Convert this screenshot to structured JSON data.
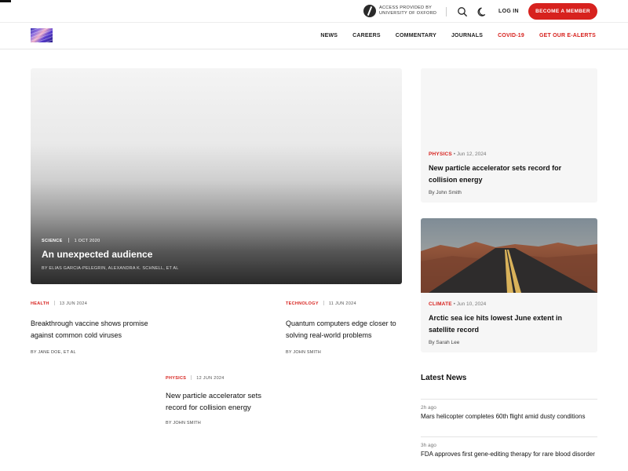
{
  "header": {
    "access_line1": "ACCESS PROVIDED BY",
    "access_line2": "UNIVERSITY OF OXFORD",
    "login": "LOG IN",
    "member_button": "BECOME A MEMBER"
  },
  "nav": {
    "items": [
      {
        "label": "NEWS",
        "accent": false
      },
      {
        "label": "CAREERS",
        "accent": false
      },
      {
        "label": "COMMENTARY",
        "accent": false
      },
      {
        "label": "JOURNALS",
        "accent": false
      },
      {
        "label": "COVID-19",
        "accent": true
      },
      {
        "label": "GET OUR E-ALERTS",
        "accent": true
      }
    ]
  },
  "colors": {
    "accent": "#d7221e",
    "text": "#111111",
    "card_bg": "#f6f6f6"
  },
  "hero": {
    "category": "SCIENCE",
    "date": "1 OCT 2020",
    "title": "An unexpected audience",
    "byline": "BY ELIAS GARCIA-PELEGRIN, ALEXANDRA K. SCHNELL, ET AL"
  },
  "grid_articles": [
    {
      "category": "HEALTH",
      "date": "13 JUN 2024",
      "title": "Breakthrough vaccine shows promise against common cold viruses",
      "byline": "BY JANE DOE, ET AL"
    },
    {
      "category": "TECHNOLOGY",
      "date": "11 JUN 2024",
      "title": "Quantum computers edge closer to solving real-world problems",
      "byline": "BY JOHN SMITH"
    },
    {
      "category": "PHYSICS",
      "date": "12 JUN 2024",
      "title": "New particle accelerator sets record for collision energy",
      "byline": "BY JOHN SMITH"
    }
  ],
  "side_cards": [
    {
      "category": "PHYSICS",
      "date": "• Jun 12, 2024",
      "title": "New particle accelerator sets record for collision energy",
      "byline": "By John Smith",
      "image": "none"
    },
    {
      "category": "CLIMATE",
      "date": "• Jun 10, 2024",
      "title": "Arctic sea ice hits lowest June extent in satellite record",
      "byline": "By Sarah Lee",
      "image": "desert-road-photo"
    }
  ],
  "latest": {
    "heading": "Latest News",
    "items": [
      {
        "ago": "2h ago",
        "headline": "Mars helicopter completes 60th flight amid dusty conditions"
      },
      {
        "ago": "3h ago",
        "headline": "FDA approves first gene-editing therapy for rare blood disorder"
      }
    ]
  }
}
